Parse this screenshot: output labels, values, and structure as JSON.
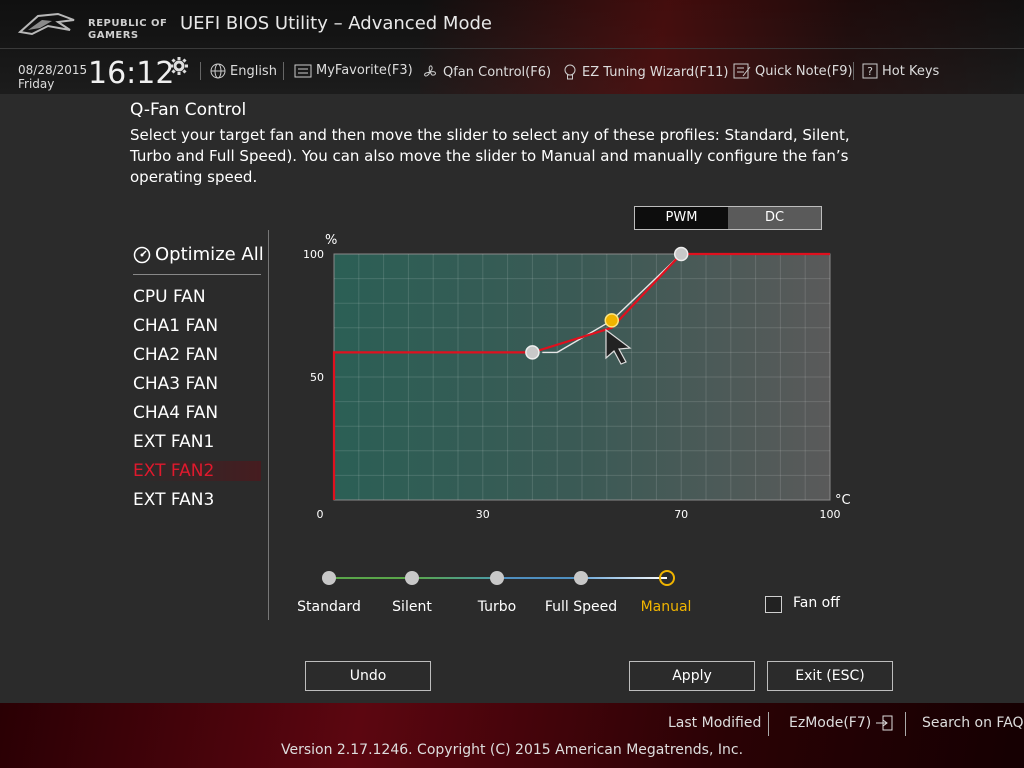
{
  "header": {
    "brand_line1": "REPUBLIC OF",
    "brand_line2": "GAMERS",
    "title": "UEFI BIOS Utility – Advanced Mode",
    "date": "08/28/2015",
    "day": "Friday",
    "time": "16:12",
    "nav": {
      "language": "English",
      "favorite": "MyFavorite(F3)",
      "qfan": "Qfan Control(F6)",
      "ez_tuning": "EZ Tuning Wizard(F11)",
      "quick_note": "Quick Note(F9)",
      "hot_keys": "Hot Keys"
    }
  },
  "section": {
    "title": "Q-Fan Control",
    "description": "Select your target fan and then move the slider to select any of these profiles: Standard, Silent, Turbo and Full Speed). You can also move the slider to Manual and manually configure the fan’s operating speed."
  },
  "fan_list": {
    "optimize_all": "Optimize All",
    "items": [
      "CPU FAN",
      "CHA1 FAN",
      "CHA2 FAN",
      "CHA3 FAN",
      "CHA4 FAN",
      "EXT FAN1",
      "EXT FAN2",
      "EXT FAN3"
    ],
    "selected": "EXT FAN2"
  },
  "mode_toggle": {
    "pwm": "PWM",
    "dc": "DC",
    "selected": "PWM"
  },
  "chart_data": {
    "type": "line",
    "y_unit": "%",
    "x_unit": "°C",
    "xlim": [
      0,
      100
    ],
    "ylim": [
      0,
      100
    ],
    "x_ticks": [
      0,
      30,
      70,
      100
    ],
    "y_ticks": [
      50,
      100
    ],
    "grid": true,
    "series": [
      {
        "color": "#e0101e",
        "points": [
          [
            0,
            0
          ],
          [
            0,
            60
          ],
          [
            40,
            60
          ],
          [
            56,
            70
          ],
          [
            70,
            100
          ],
          [
            100,
            100
          ]
        ]
      },
      {
        "color": "#e6e6e6",
        "points": [
          [
            42,
            60
          ],
          [
            45,
            60
          ],
          [
            56,
            73
          ],
          [
            70,
            100
          ]
        ]
      }
    ],
    "control_points": [
      {
        "x": 40,
        "y": 60,
        "active": false
      },
      {
        "x": 56,
        "y": 73,
        "active": true
      },
      {
        "x": 70,
        "y": 100,
        "active": false
      }
    ]
  },
  "profiles": {
    "items": [
      "Standard",
      "Silent",
      "Turbo",
      "Full Speed",
      "Manual"
    ],
    "selected": "Manual"
  },
  "fan_off_label": "Fan off",
  "buttons": {
    "undo": "Undo",
    "apply": "Apply",
    "exit": "Exit (ESC)"
  },
  "footer": {
    "last_modified": "Last Modified",
    "ez_mode": "EzMode(F7)",
    "search_faq": "Search on FAQ",
    "copyright": "Version 2.17.1246. Copyright (C) 2015 American Megatrends, Inc."
  },
  "colors": {
    "accent_red": "#e0192d",
    "manual_yellow": "#f0b400",
    "chart_bg": "#2b5a52"
  }
}
